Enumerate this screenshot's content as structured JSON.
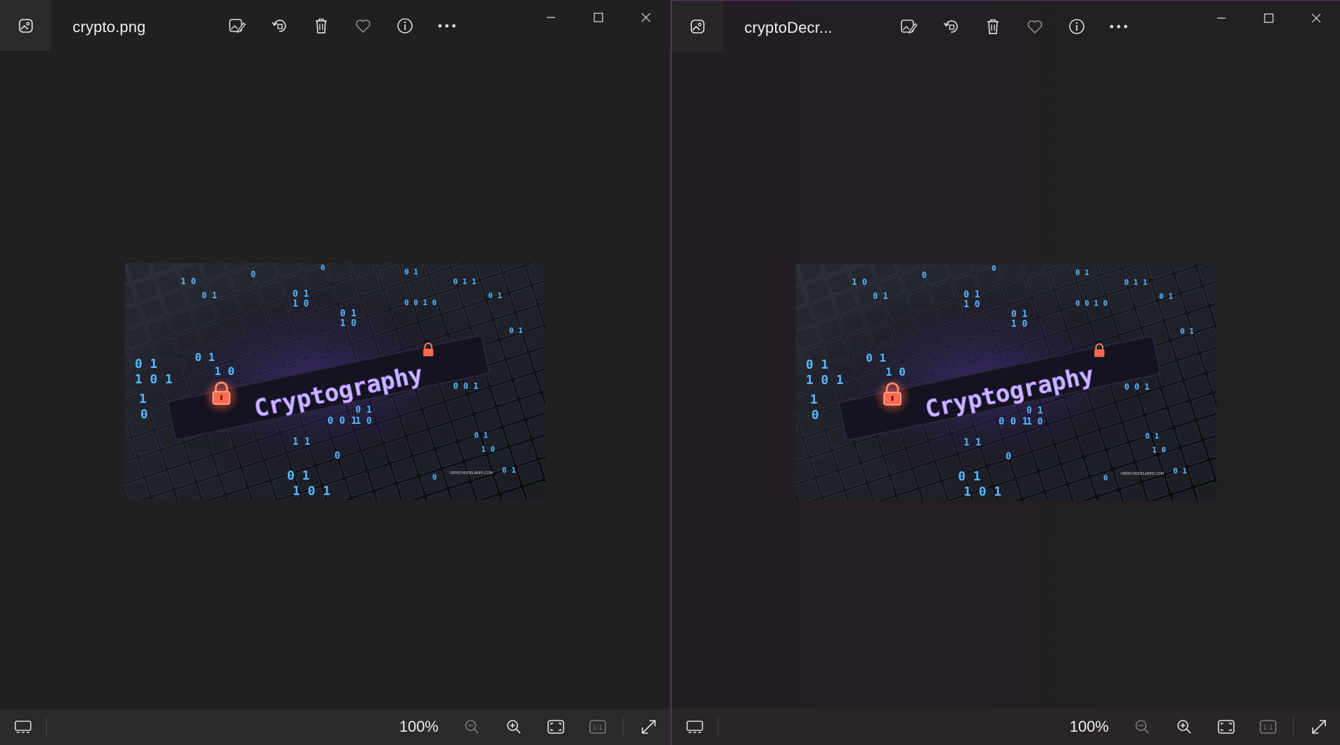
{
  "windows": [
    {
      "id": "left",
      "file_name": "crypto.png",
      "zoom": "100%",
      "image": {
        "headline": "Cryptography",
        "watermark": "DERECHODELARED.COM"
      }
    },
    {
      "id": "right",
      "file_name": "cryptoDecr...",
      "zoom": "100%",
      "image": {
        "headline": "Cryptography",
        "watermark": "DERECHODELARED.COM"
      }
    }
  ],
  "toolbar_icons": [
    "edit-image-icon",
    "rotate-icon",
    "delete-icon",
    "favorite-icon",
    "info-icon",
    "more-icon"
  ],
  "window_controls": [
    "minimize-icon",
    "maximize-icon",
    "close-icon"
  ],
  "bottom_icons": [
    "filmstrip-icon",
    "zoom-out-icon",
    "zoom-in-icon",
    "fit-to-window-icon",
    "actual-size-icon",
    "full-screen-icon"
  ],
  "colors": {
    "background": "#202020",
    "bottom_bar": "#2a2a2a",
    "accent_border": "#7a3a8a",
    "headline_glow": "#b59cff",
    "lock_glow": "#ff6a55",
    "digit_glow": "#4fb6ff"
  }
}
